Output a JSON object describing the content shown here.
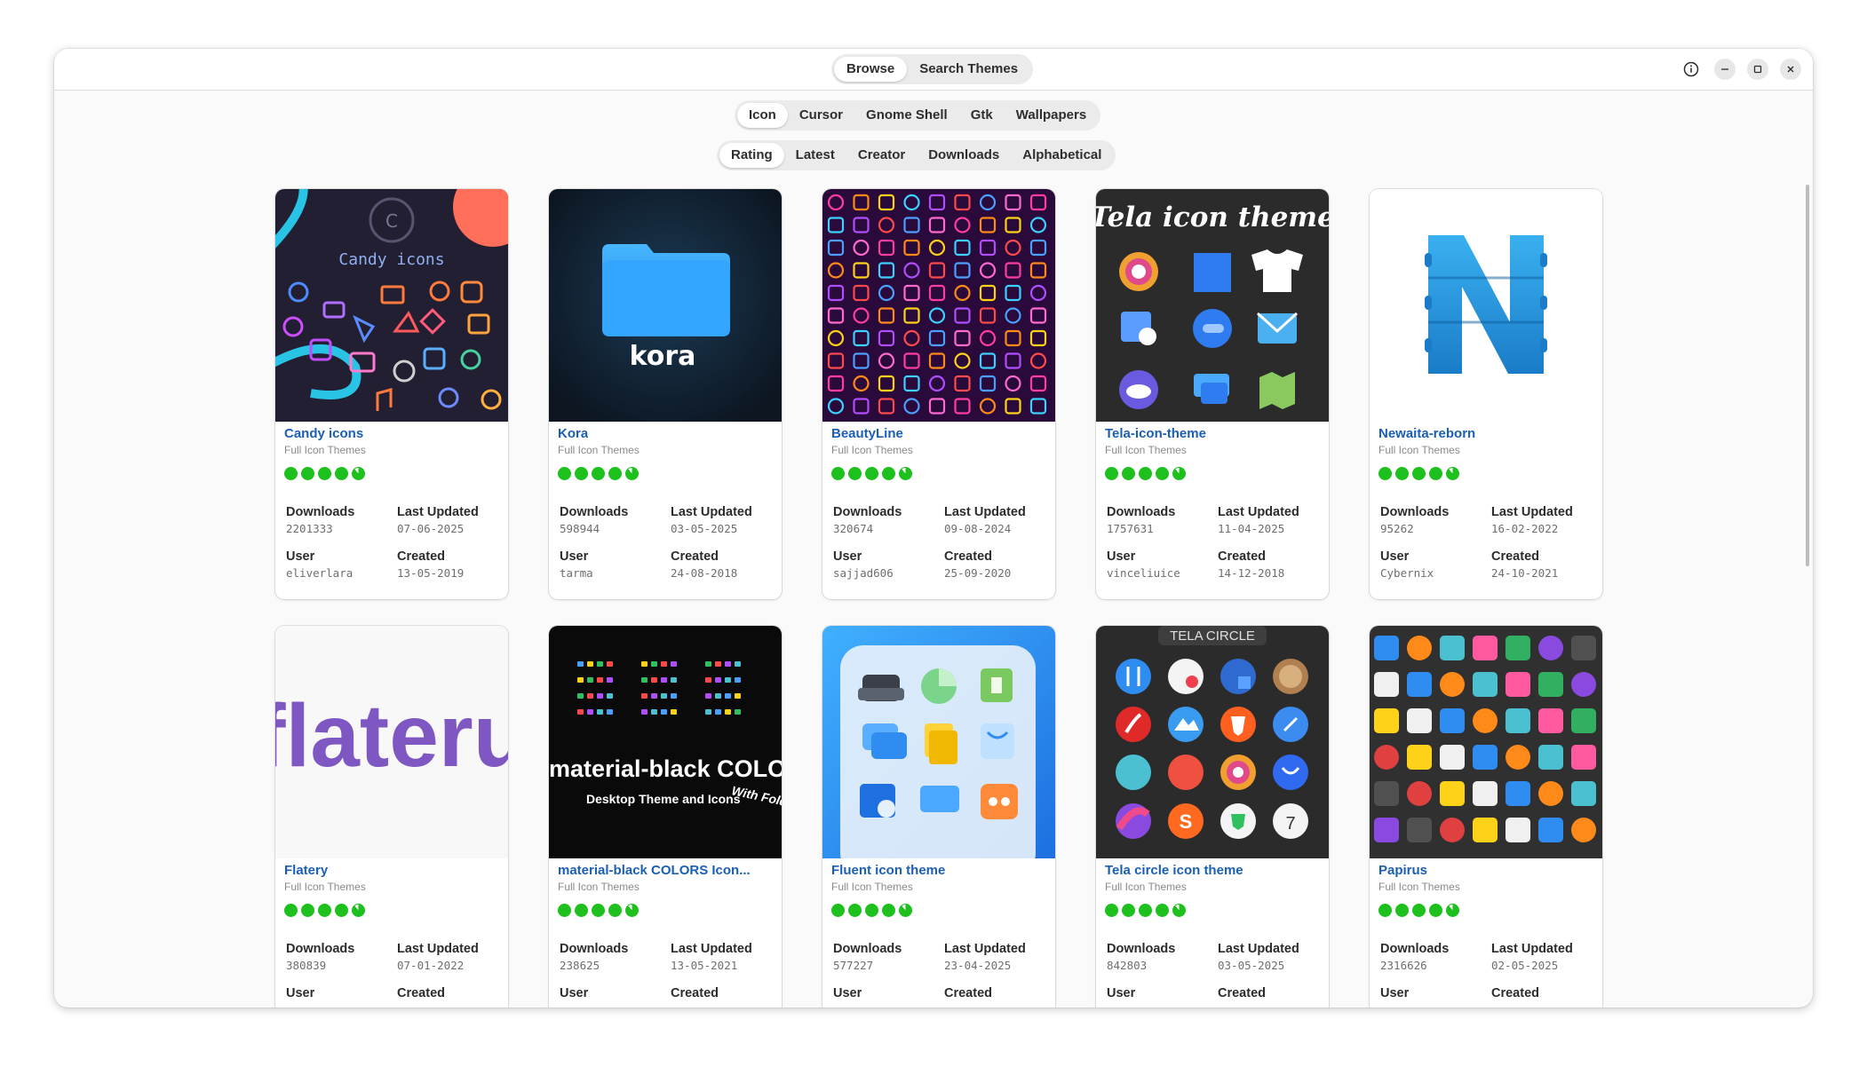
{
  "header": {
    "view_switcher": [
      {
        "label": "Browse",
        "active": true
      },
      {
        "label": "Search Themes",
        "active": false
      }
    ],
    "controls": [
      "info-icon",
      "minimize-icon",
      "maximize-icon",
      "close-icon"
    ]
  },
  "categories": [
    {
      "label": "Icon",
      "active": true
    },
    {
      "label": "Cursor",
      "active": false
    },
    {
      "label": "Gnome Shell",
      "active": false
    },
    {
      "label": "Gtk",
      "active": false
    },
    {
      "label": "Wallpapers",
      "active": false
    }
  ],
  "sort": [
    {
      "label": "Rating",
      "active": true
    },
    {
      "label": "Latest",
      "active": false
    },
    {
      "label": "Creator",
      "active": false
    },
    {
      "label": "Downloads",
      "active": false
    },
    {
      "label": "Alphabetical",
      "active": false
    }
  ],
  "labels": {
    "downloads": "Downloads",
    "last_updated": "Last Updated",
    "user": "User",
    "created": "Created"
  },
  "cards": [
    {
      "title": "Candy icons",
      "subtitle": "Full Icon Themes",
      "downloads": "2201333",
      "last_updated": "07-06-2025",
      "user": "eliverlara",
      "created": "13-05-2019",
      "thumb_text": "Candy icons"
    },
    {
      "title": "Kora",
      "subtitle": "Full Icon Themes",
      "downloads": "598944",
      "last_updated": "03-05-2025",
      "user": "tarma",
      "created": "24-08-2018",
      "thumb_text": "kora"
    },
    {
      "title": "BeautyLine",
      "subtitle": "Full Icon Themes",
      "downloads": "320674",
      "last_updated": "09-08-2024",
      "user": "sajjad606",
      "created": "25-09-2020"
    },
    {
      "title": "Tela-icon-theme",
      "subtitle": "Full Icon Themes",
      "downloads": "1757631",
      "last_updated": "11-04-2025",
      "user": "vinceliuice",
      "created": "14-12-2018",
      "thumb_text": "Tela icon theme"
    },
    {
      "title": "Newaita-reborn",
      "subtitle": "Full Icon Themes",
      "downloads": "95262",
      "last_updated": "16-02-2022",
      "user": "Cybernix",
      "created": "24-10-2021"
    },
    {
      "title": "Flatery",
      "subtitle": "Full Icon Themes",
      "downloads": "380839",
      "last_updated": "07-01-2022",
      "user": "",
      "created": "",
      "thumb_text": "flateru"
    },
    {
      "title": "material-black COLORS Icon...",
      "subtitle": "Full Icon Themes",
      "downloads": "238625",
      "last_updated": "13-05-2021",
      "user": "",
      "created": "",
      "thumb_text": "material-black COLORS",
      "thumb_text2": "Desktop Theme and Icons",
      "thumb_text3": "With Fold"
    },
    {
      "title": "Fluent icon theme",
      "subtitle": "Full Icon Themes",
      "downloads": "577227",
      "last_updated": "23-04-2025",
      "user": "",
      "created": ""
    },
    {
      "title": "Tela circle icon theme",
      "subtitle": "Full Icon Themes",
      "downloads": "842803",
      "last_updated": "03-05-2025",
      "user": "",
      "created": "",
      "thumb_text": "TELA CIRCLE",
      "thumb_text2": "7"
    },
    {
      "title": "Papirus",
      "subtitle": "Full Icon Themes",
      "downloads": "2316626",
      "last_updated": "02-05-2025",
      "user": "",
      "created": ""
    }
  ],
  "rating_dots": {
    "full": 4,
    "partial": 1
  },
  "colors": {
    "accent": "#1a5fb4",
    "rating": "#1ec01e"
  }
}
